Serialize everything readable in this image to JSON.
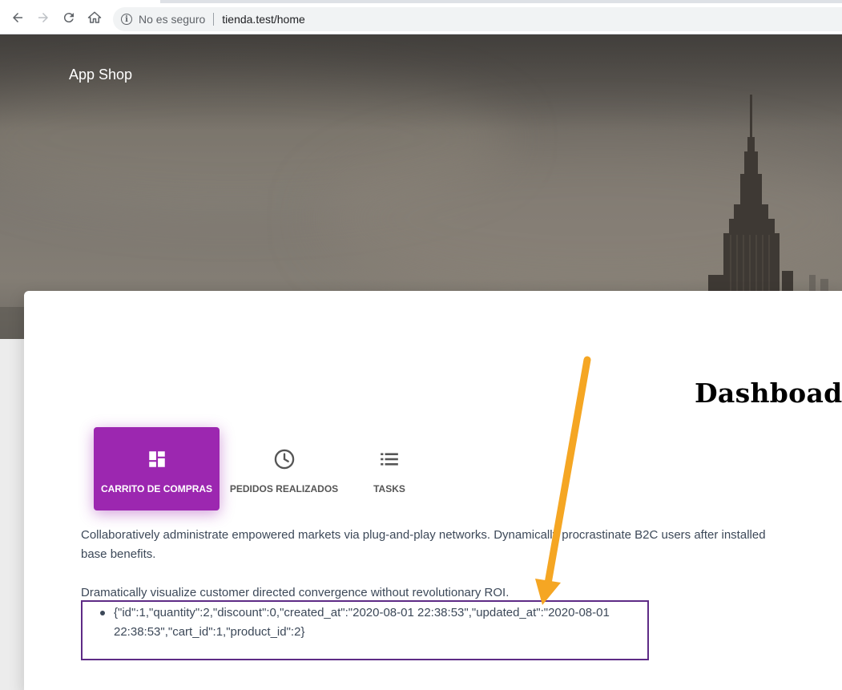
{
  "browser": {
    "security_label": "No es seguro",
    "url": "tienda.test/home"
  },
  "navbar": {
    "brand": "App Shop"
  },
  "page": {
    "title": "Dashboad"
  },
  "tabs": [
    {
      "label": "CARRITO DE COMPRAS",
      "icon": "dashboard-icon",
      "active": true
    },
    {
      "label": "PEDIDOS REALIZADOS",
      "icon": "clock-icon",
      "active": false
    },
    {
      "label": "TASKS",
      "icon": "list-icon",
      "active": false
    }
  ],
  "content": {
    "paragraph1": "Collaboratively administrate empowered markets via plug-and-play networks. Dynamically procrastinate B2C users after installed base benefits.",
    "paragraph2": "Dramatically visualize customer directed convergence without revolutionary ROI.",
    "items": [
      "{\"id\":1,\"quantity\":2,\"discount\":0,\"created_at\":\"2020-08-01 22:38:53\",\"updated_at\":\"2020-08-01 22:38:53\",\"cart_id\":1,\"product_id\":2}"
    ]
  },
  "colors": {
    "accent": "#9c27b0",
    "highlight_border": "#5e2b86",
    "annotation_arrow": "#f5a623"
  }
}
